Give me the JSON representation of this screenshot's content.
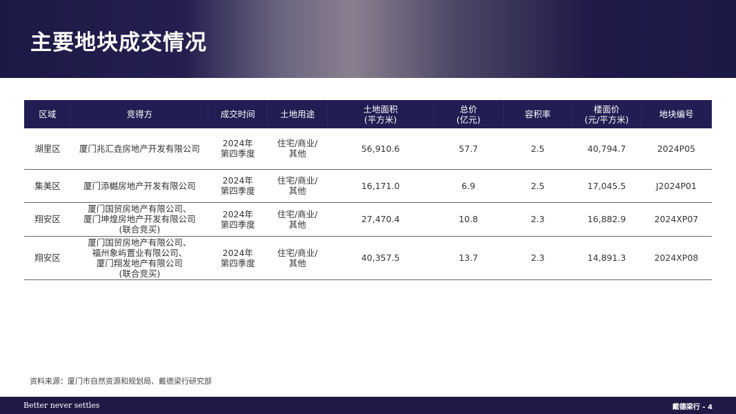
{
  "title": "主要地块成交情况",
  "headers": [
    "区域",
    "竞得方",
    "成交时间",
    "土地用途",
    "土地面积\n(平方米)",
    "总价\n(亿元)",
    "容积率",
    "楼面价\n(元/平方米)",
    "地块编号"
  ],
  "rows": [
    [
      "湖里区",
      "厦门兆汇垚房地产开发有限公司",
      "2024年\n第四季度",
      "住宅/商业/\n其他",
      "56,910.6",
      "57.7",
      "2.5",
      "40,794.7",
      "2024P05"
    ],
    [
      "集美区",
      "厦门添樾房地产开发有限公司",
      "2024年\n第四季度",
      "住宅/商业/\n其他",
      "16,171.0",
      "6.9",
      "2.5",
      "17,045.5",
      "J2024P01"
    ],
    [
      "翔安区",
      "厦门国贸房地产有限公司、\n厦门坤煌房地产开发有限公司\n(联合竞买)",
      "2024年\n第四季度",
      "住宅/商业/\n其他",
      "27,470.4",
      "10.8",
      "2.3",
      "16,882.9",
      "2024XP07"
    ],
    [
      "翔安区",
      "厦门国贸房地产有限公司、\n福州象屿置业有限公司、\n厦门翔发地产有限公司\n(联合竞买)",
      "2024年\n第四季度",
      "住宅/商业/\n其他",
      "40,357.5",
      "13.7",
      "2.3",
      "14,891.3",
      "2024XP08"
    ]
  ],
  "source": "资料来源：厦门市自然资源和规划局、戴德梁行研究部",
  "footer": {
    "slogan": "Better never settles",
    "page": "戴德梁行 - 4"
  }
}
